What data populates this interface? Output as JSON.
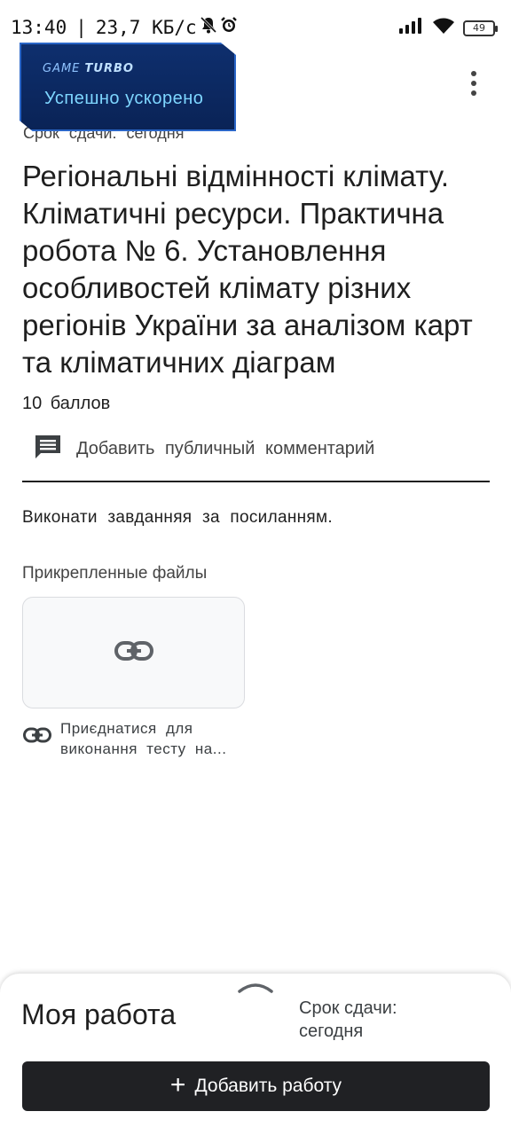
{
  "status_bar": {
    "time": "13:40",
    "speed": "23,7 КБ/с",
    "battery": "49"
  },
  "toast": {
    "brand_prefix": "GAME",
    "brand_suffix": "TURBO",
    "message": "Успешно ускорено"
  },
  "assignment": {
    "due": "Срок сдачи: сегодня",
    "title": "Регіональні відмінності клімату. Кліматичні ресурси. Практична робота № 6. Установлення особливостей клімату різних регіонів України за аналізом карт та кліматичних діаграм",
    "points": "10 баллов",
    "comment_label": "Добавить публичный комментарий",
    "instructions": "Виконати завданняя за посиланням.",
    "attachments_heading": "Прикрепленные файлы",
    "attachment_name": "Приєднатися для виконання тесту на..."
  },
  "bottom_sheet": {
    "title": "Моя работа",
    "due_line1": "Срок сдачи:",
    "due_line2": "сегодня",
    "add_button": "Добавить работу"
  }
}
